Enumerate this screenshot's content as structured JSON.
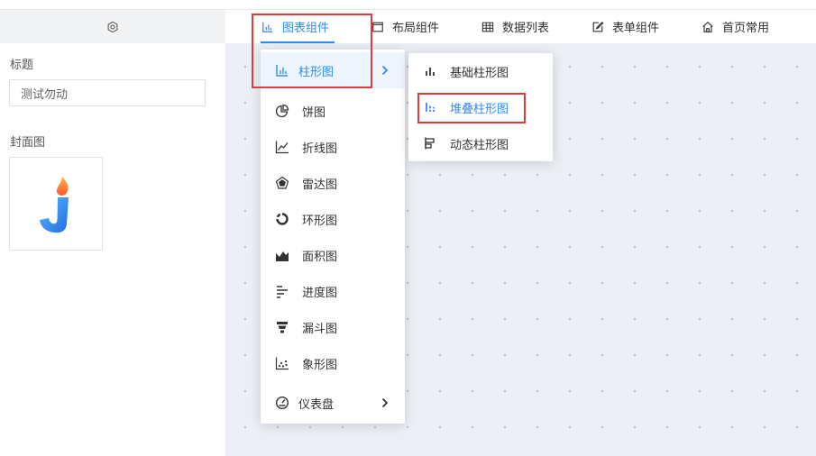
{
  "left_panel": {
    "settings_icon": "gear-icon",
    "title_label": "标题",
    "title_value": "测试勿动",
    "cover_label": "封面图"
  },
  "tabs": [
    {
      "label": "图表组件",
      "icon": "bar-chart-icon",
      "active": true
    },
    {
      "label": "布局组件",
      "icon": "layout-icon"
    },
    {
      "label": "数据列表",
      "icon": "table-icon"
    },
    {
      "label": "表单组件",
      "icon": "edit-form-icon"
    },
    {
      "label": "首页常用",
      "icon": "home-icon"
    }
  ],
  "chart_menu": {
    "items": [
      {
        "label": "柱形图",
        "icon": "bar-chart-icon",
        "has_submenu": true,
        "active": true
      },
      {
        "label": "饼图",
        "icon": "pie-chart-icon"
      },
      {
        "label": "折线图",
        "icon": "line-chart-icon"
      },
      {
        "label": "雷达图",
        "icon": "radar-chart-icon"
      },
      {
        "label": "环形图",
        "icon": "ring-chart-icon"
      },
      {
        "label": "面积图",
        "icon": "area-chart-icon"
      },
      {
        "label": "进度图",
        "icon": "progress-chart-icon"
      },
      {
        "label": "漏斗图",
        "icon": "funnel-chart-icon"
      },
      {
        "label": "象形图",
        "icon": "pictorial-chart-icon"
      },
      {
        "label": "仪表盘",
        "icon": "gauge-icon",
        "has_submenu": true
      }
    ]
  },
  "bar_submenu": {
    "items": [
      {
        "label": "基础柱形图",
        "icon": "basic-bar-icon"
      },
      {
        "label": "堆叠柱形图",
        "icon": "stacked-bar-icon",
        "active": true
      },
      {
        "label": "动态柱形图",
        "icon": "dynamic-bar-icon"
      }
    ]
  },
  "colors": {
    "accent": "#2d8cf0",
    "highlight_box": "#e23b3b",
    "canvas_bg": "#ebeef5",
    "panel_header_bg": "#f2f3f5"
  }
}
